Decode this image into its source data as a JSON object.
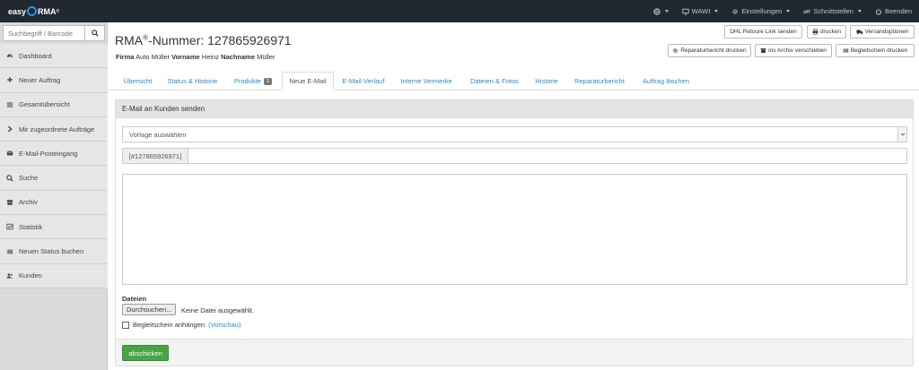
{
  "brand": {
    "left": "easy",
    "right": "RMA",
    "reg": "®"
  },
  "nav": {
    "globe_label": "",
    "wawi": "WAWI",
    "settings": "Einstellungen",
    "interfaces": "Schnittstellen",
    "logout": "Beenden"
  },
  "sidebar": {
    "search_placeholder": "Suchbegriff / Barcode",
    "items": [
      {
        "label": "Dashboard",
        "icon": "dashboard-icon"
      },
      {
        "label": "Neuer Auftrag",
        "icon": "plus-icon"
      },
      {
        "label": "Gesamtübersicht",
        "icon": "list-icon"
      },
      {
        "label": "Mir zugeordnete Aufträge",
        "icon": "chevron-right-icon"
      },
      {
        "label": "E-Mail-Posteingang",
        "icon": "envelope-icon"
      },
      {
        "label": "Suche",
        "icon": "search-icon"
      },
      {
        "label": "Archiv",
        "icon": "archive-icon"
      },
      {
        "label": "Statistik",
        "icon": "chart-icon"
      },
      {
        "label": "Neuen Status buchen",
        "icon": "barcode-icon"
      },
      {
        "label": "Kunden",
        "icon": "users-icon"
      }
    ]
  },
  "header": {
    "title_prefix": "RMA",
    "title_reg": "®",
    "title_suffix": "-Nummer: 127865926971",
    "firma_label": "Firma",
    "firma_value": "Auto Müller",
    "vorname_label": "Vorname",
    "vorname_value": "Heinz",
    "nachname_label": "Nachname",
    "nachname_value": "Müller"
  },
  "actions": {
    "dhl": "DHL Retoure Link senden",
    "print": "drucken",
    "shipping": "Versandoptionen",
    "repair_report": "Reparaturbericht drucken",
    "archive": "ins Archiv verschieben",
    "slip": "Begleitschein drucken"
  },
  "tabs": [
    {
      "label": "Übersicht"
    },
    {
      "label": "Status & Historie"
    },
    {
      "label": "Produkte",
      "badge": "1"
    },
    {
      "label": "Neue E-Mail",
      "active": true
    },
    {
      "label": "E-Mail-Verlauf"
    },
    {
      "label": "Interne Vermerke"
    },
    {
      "label": "Dateien & Fotos"
    },
    {
      "label": "Historie"
    },
    {
      "label": "Reparaturbericht"
    },
    {
      "label": "Auftrag löschen"
    }
  ],
  "email_form": {
    "heading": "E-Mail an Kunden senden",
    "template_select": "Vorlage auswählen",
    "subject_prefix": "[#127865926971]",
    "subject_value": "",
    "body_value": "",
    "files_label": "Dateien",
    "browse_button": "Durchsuchen...",
    "no_file": "Keine Datei ausgewählt.",
    "attach_label": "Begleitschein anhängen",
    "preview_link": "(Vorschau)",
    "send_button": "abschicken"
  },
  "colors": {
    "navbar": "#222831",
    "link": "#2d8ac7",
    "send": "#47a447",
    "logo_ring": "#1e9ad6"
  }
}
